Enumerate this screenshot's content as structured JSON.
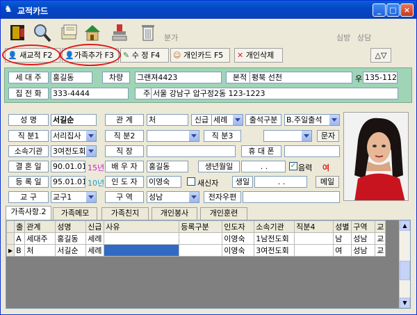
{
  "window": {
    "title": "교적카드"
  },
  "toolbar": {
    "faint_left": "분가",
    "faint_right_1": "심방",
    "faint_right_2": "상담"
  },
  "actions": {
    "new_member": "새교적 F2",
    "add_family": "가족추가 F3",
    "edit": "수 정 F4",
    "personal_card": "개인카드 F5",
    "delete": "개인삭제",
    "nav": "△▽"
  },
  "household": {
    "head_label": "세 대 주",
    "head_value": "홍길동",
    "car_label": "차량",
    "car_value": "그랜져4423",
    "origin_label": "본적",
    "origin_value": "평북 선천",
    "zip_prefix": "우",
    "zip_value": "135-112",
    "phone_label": "집 전 화",
    "phone_value": "333-4444",
    "address_label": "주 소",
    "address_value": "서울 강남구 압구정2동 123-1223"
  },
  "person": {
    "name_label": "성 명",
    "name_value": "서길순",
    "relation_label": "관 계",
    "relation_value": "처",
    "new_old_label": "신급",
    "new_old_value": "세례",
    "attend_label": "출석구분",
    "attend_value": "B.주일출석",
    "duty1_label": "직 분1",
    "duty1_value": "서리집사",
    "duty2_label": "직 분2",
    "duty2_value": "",
    "duty3_label": "직 분3",
    "duty3_value": "",
    "sms_button": "문자",
    "org_label": "소속기관",
    "org_value": "3여전도회",
    "job_label": "직 장",
    "job_value": "",
    "mobile_label": "휴 대 폰",
    "mobile_value": "",
    "wedding_label": "결 혼 일",
    "wedding_value": "90.01.01",
    "wedding_years": "15년",
    "spouse_label": "배 우 자",
    "spouse_value": "홍길동",
    "birth_label": "생년월일",
    "birth_value": ". .",
    "lunar_label": "음력",
    "gender_value": "여",
    "register_label": "등 록 일",
    "register_value": "95.01.01",
    "register_years": "10년",
    "guide_label": "인 도 자",
    "guide_value": "이영숙",
    "newcomer_label": "새신자",
    "birthday_label": "생일",
    "birthday_value": ". .",
    "mail_button": "메일",
    "district_label": "교 구",
    "district_value": "교구1",
    "area_label": "구 역",
    "area_value": "성남",
    "epost_label": "전자우편",
    "epost_value": ""
  },
  "tabs": [
    "가족사항.2",
    "가족메모",
    "가족친지",
    "개인봉사",
    "개인훈련"
  ],
  "grid": {
    "headers": [
      "출",
      "관계",
      "성명",
      "신급",
      "사유",
      "등록구분",
      "인도자",
      "소속기관",
      "직분4",
      "성별",
      "구역",
      "교"
    ],
    "rows": [
      [
        "A",
        "세대주",
        "홍길동",
        "세례",
        "",
        "",
        "이영숙",
        "1남전도회",
        "",
        "남",
        "성남",
        "교"
      ],
      [
        "B",
        "처",
        "서길순",
        "세례",
        "",
        "",
        "이영숙",
        "3여전도회",
        "",
        "여",
        "성남",
        "교"
      ]
    ]
  }
}
